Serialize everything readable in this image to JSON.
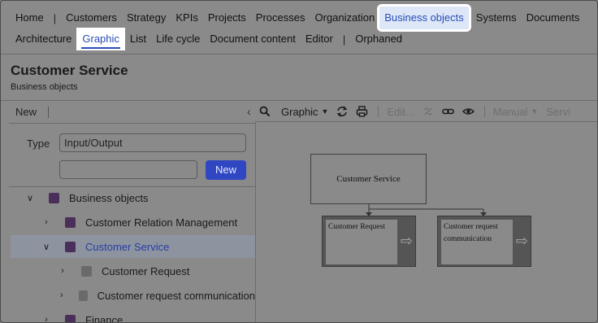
{
  "nav_primary": [
    "Home",
    "Customers",
    "Strategy",
    "KPIs",
    "Projects",
    "Processes",
    "Organization",
    "Business objects",
    "Systems",
    "Documents"
  ],
  "nav_secondary": [
    "Architecture",
    "Graphic",
    "List",
    "Life cycle",
    "Document content",
    "Editor",
    "Orphaned"
  ],
  "page": {
    "title": "Customer Service",
    "subtitle": "Business objects"
  },
  "left_panel": {
    "new_label": "New",
    "type_label": "Type",
    "type_value": "Input/Output",
    "new_input_value": "",
    "new_button": "New"
  },
  "tree": [
    {
      "label": "Business objects",
      "color": "purple",
      "expanded": true
    },
    {
      "label": "Customer Relation Management",
      "color": "purple",
      "expanded": false
    },
    {
      "label": "Customer Service",
      "color": "purple",
      "expanded": true,
      "selected": true
    },
    {
      "label": "Customer Request",
      "color": "gray",
      "expanded": false
    },
    {
      "label": "Customer request communication",
      "color": "gray",
      "expanded": false
    },
    {
      "label": "Finance",
      "color": "purple",
      "expanded": false
    }
  ],
  "toolbar": {
    "view": "Graphic",
    "edit": "Edit...",
    "manual": "Manual",
    "service": "Servi"
  },
  "diagram": {
    "main": "Customer Service",
    "children": [
      "Customer Request",
      "Customer request communication"
    ]
  },
  "colors": {
    "accent": "#2a4db8",
    "button": "#2f47c2",
    "purple": "#4a2f5a"
  }
}
